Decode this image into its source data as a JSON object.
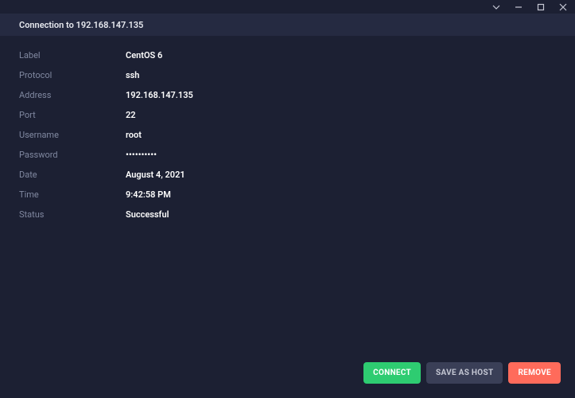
{
  "header": {
    "title": "Connection to 192.168.147.135"
  },
  "details": {
    "label_label": "Label",
    "label_value": "CentOS 6",
    "protocol_label": "Protocol",
    "protocol_value": "ssh",
    "address_label": "Address",
    "address_value": "192.168.147.135",
    "port_label": "Port",
    "port_value": "22",
    "username_label": "Username",
    "username_value": "root",
    "password_label": "Password",
    "password_value": "••••••••••",
    "date_label": "Date",
    "date_value": "August 4, 2021",
    "time_label": "Time",
    "time_value": "9:42:58 PM",
    "status_label": "Status",
    "status_value": "Successful"
  },
  "footer": {
    "connect": "CONNECT",
    "save_as_host": "SAVE AS HOST",
    "remove": "REMOVE"
  }
}
